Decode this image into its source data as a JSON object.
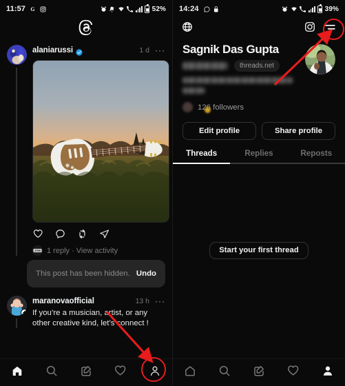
{
  "left_phone": {
    "status_bar": {
      "time": "11:57",
      "left_icons": [
        "google-icon",
        "instagram-icon"
      ],
      "right_icons": [
        "alarm-icon",
        "notifications-off-icon",
        "wifi-icon",
        "missed-call-icon",
        "signal-icon",
        "battery-icon"
      ],
      "battery_percent": "52%"
    },
    "header": {
      "logo": "threads-logo"
    },
    "post": {
      "username": "alaniarussi",
      "verified": true,
      "timestamp": "1 d",
      "menu": "···",
      "media": "guitar-sunset-photo",
      "actions": [
        "like-icon",
        "comment-icon",
        "repost-icon",
        "share-icon"
      ],
      "replies_text": "1 reply · View activity"
    },
    "hidden_banner": {
      "message": "This post has been hidden.",
      "undo_label": "Undo"
    },
    "post2": {
      "username": "maranovaofficial",
      "timestamp": "13 h",
      "menu": "···",
      "text": "If you’re a musician, artist, or any other creative kind, let’s connect !"
    },
    "bottom_nav": [
      {
        "name": "home-icon",
        "active": true
      },
      {
        "name": "search-icon",
        "active": false
      },
      {
        "name": "compose-icon",
        "active": false
      },
      {
        "name": "activity-heart-icon",
        "active": false
      },
      {
        "name": "profile-icon",
        "active": false,
        "highlighted": true
      }
    ]
  },
  "right_phone": {
    "status_bar": {
      "time": "14:24",
      "left_icons": [
        "whatsapp-icon",
        "lock-icon"
      ],
      "right_icons": [
        "alarm-icon",
        "wifi-icon",
        "missed-call-icon",
        "signal-icon",
        "battery-icon"
      ],
      "battery_percent": "39%"
    },
    "top_bar": {
      "globe": "globe-icon",
      "instagram": "instagram-icon",
      "menu": "hamburger-menu-icon",
      "menu_highlighted": true
    },
    "profile": {
      "name": "Sagnik Das Gupta",
      "handle": "",
      "domain_pill": "threads.net",
      "bio": "",
      "followers": "126 followers",
      "avatar": "user-profile-photo"
    },
    "buttons": {
      "edit_profile": "Edit profile",
      "share_profile": "Share profile"
    },
    "tabs": [
      {
        "label": "Threads",
        "active": true
      },
      {
        "label": "Replies",
        "active": false
      },
      {
        "label": "Reposts",
        "active": false
      }
    ],
    "empty_state": {
      "start_label": "Start your first thread"
    },
    "bottom_nav": [
      {
        "name": "home-icon",
        "active": false
      },
      {
        "name": "search-icon",
        "active": false
      },
      {
        "name": "compose-icon",
        "active": false
      },
      {
        "name": "activity-heart-icon",
        "active": false
      },
      {
        "name": "profile-icon",
        "active": true
      }
    ]
  },
  "annotations": {
    "accent_color": "#e81c1c",
    "arrow_left": "arrow-pointing-to-profile-tab",
    "ring_left": "circle-around-profile-nav-icon",
    "arrow_right": "arrow-pointing-to-hamburger-menu",
    "ring_right": "circle-around-hamburger-menu"
  }
}
